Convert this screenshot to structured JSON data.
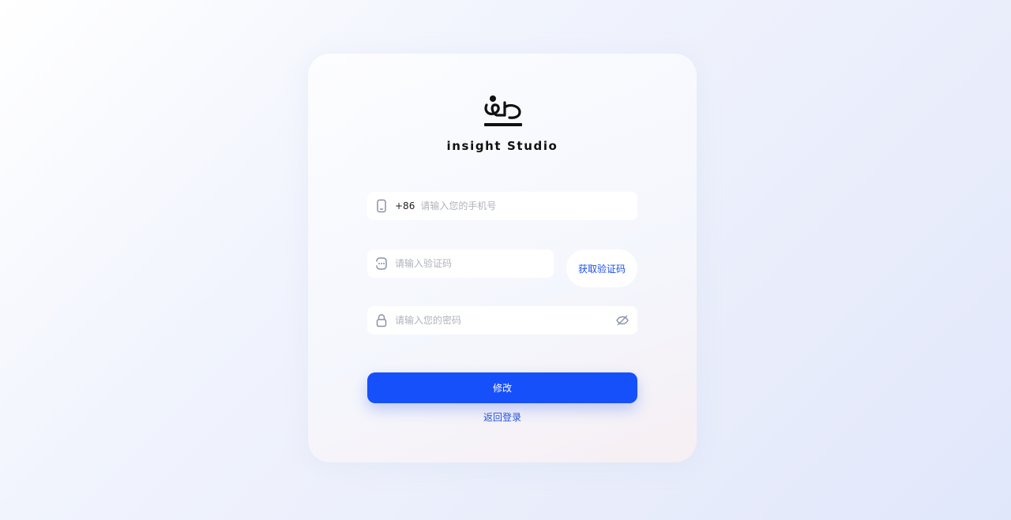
{
  "brand": {
    "logo_icon": "insight-studio-logo-icon",
    "name": "insight Studio"
  },
  "form": {
    "phone": {
      "icon": "phone-icon",
      "country_code": "+86",
      "value": "",
      "placeholder": "请输入您的手机号"
    },
    "code": {
      "icon": "message-icon",
      "value": "",
      "placeholder": "请输入验证码",
      "get_code_label": "获取验证码"
    },
    "password": {
      "icon": "lock-icon",
      "value": "",
      "placeholder": "请输入您的密码",
      "visibility_icon": "eye-off-icon"
    },
    "submit_label": "修改",
    "back_label": "返回登录"
  },
  "colors": {
    "primary": "#1650fb",
    "link": "#2553d8",
    "icon": "#8a92a6"
  }
}
